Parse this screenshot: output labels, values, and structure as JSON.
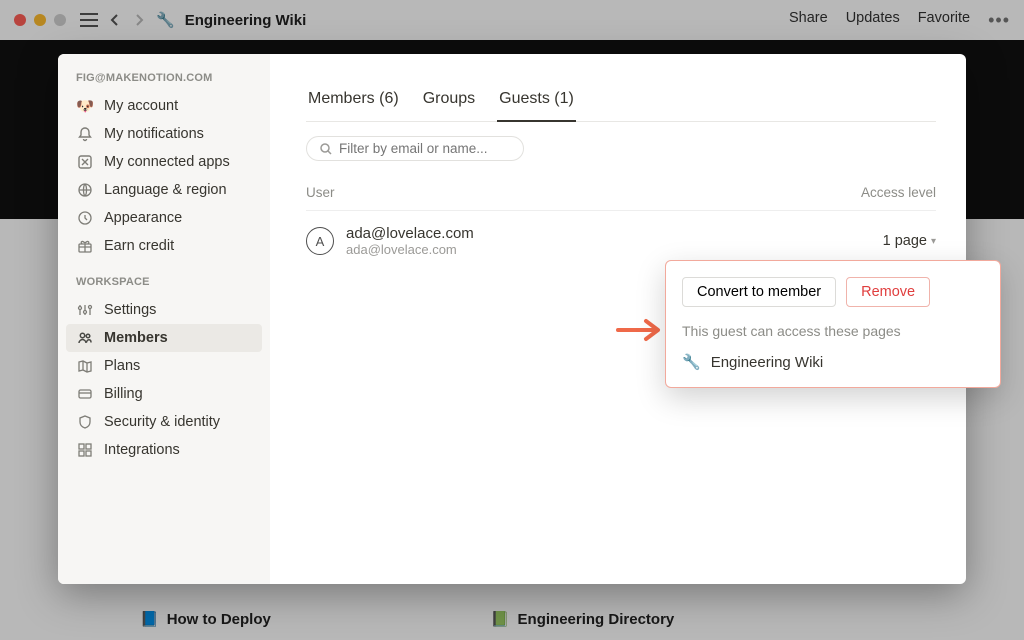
{
  "titlebar": {
    "page_title": "Engineering Wiki",
    "share": "Share",
    "updates": "Updates",
    "favorite": "Favorite"
  },
  "sidebar": {
    "account_header": "FIG@MAKENOTION.COM",
    "workspace_header": "WORKSPACE",
    "account_items": [
      {
        "label": "My account"
      },
      {
        "label": "My notifications"
      },
      {
        "label": "My connected apps"
      },
      {
        "label": "Language & region"
      },
      {
        "label": "Appearance"
      },
      {
        "label": "Earn credit"
      }
    ],
    "workspace_items": [
      {
        "label": "Settings"
      },
      {
        "label": "Members"
      },
      {
        "label": "Plans"
      },
      {
        "label": "Billing"
      },
      {
        "label": "Security & identity"
      },
      {
        "label": "Integrations"
      }
    ]
  },
  "tabs": {
    "members": "Members (6)",
    "groups": "Groups",
    "guests": "Guests (1)"
  },
  "filter": {
    "placeholder": "Filter by email or name..."
  },
  "table": {
    "user_header": "User",
    "access_header": "Access level",
    "rows": [
      {
        "initial": "A",
        "name": "ada@lovelace.com",
        "email": "ada@lovelace.com",
        "access": "1 page"
      }
    ]
  },
  "popover": {
    "convert": "Convert to member",
    "remove": "Remove",
    "caption": "This guest can access these pages",
    "page": "Engineering Wiki"
  },
  "bg_pages": {
    "left": "How to Deploy",
    "right": "Engineering Directory"
  }
}
